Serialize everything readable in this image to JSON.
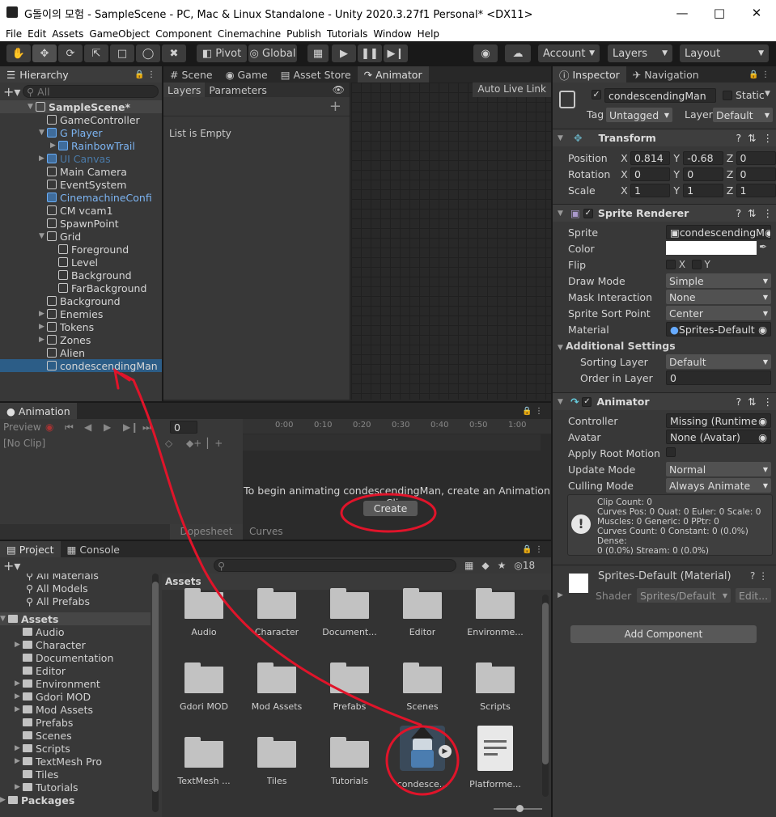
{
  "window": {
    "title": "G돌이의 모험 - SampleScene - PC, Mac & Linux Standalone - Unity 2020.3.27f1 Personal* <DX11>"
  },
  "menu": [
    "File",
    "Edit",
    "Assets",
    "GameObject",
    "Component",
    "Cinemachine",
    "Publish",
    "Tutorials",
    "Window",
    "Help"
  ],
  "toolbar": {
    "pivot": "Pivot",
    "global": "Global",
    "account": "Account",
    "layers": "Layers",
    "layout": "Layout"
  },
  "hierarchy": {
    "tab": "Hierarchy",
    "search_placeholder": "All",
    "items": [
      {
        "label": "SampleScene*",
        "indent": 0,
        "type": "scene"
      },
      {
        "label": "GameController",
        "indent": 1
      },
      {
        "label": "G Player",
        "indent": 1,
        "blue": true
      },
      {
        "label": "RainbowTrail",
        "indent": 2,
        "blue": true
      },
      {
        "label": "UI Canvas",
        "indent": 1,
        "blue": true,
        "dim": true
      },
      {
        "label": "Main Camera",
        "indent": 1
      },
      {
        "label": "EventSystem",
        "indent": 1
      },
      {
        "label": "CinemachineConfi",
        "indent": 1,
        "blue": true
      },
      {
        "label": "CM vcam1",
        "indent": 1
      },
      {
        "label": "SpawnPoint",
        "indent": 1
      },
      {
        "label": "Grid",
        "indent": 1
      },
      {
        "label": "Foreground",
        "indent": 2
      },
      {
        "label": "Level",
        "indent": 2
      },
      {
        "label": "Background",
        "indent": 2
      },
      {
        "label": "FarBackground",
        "indent": 2
      },
      {
        "label": "Background",
        "indent": 1
      },
      {
        "label": "Enemies",
        "indent": 1
      },
      {
        "label": "Tokens",
        "indent": 1
      },
      {
        "label": "Zones",
        "indent": 1
      },
      {
        "label": "Alien",
        "indent": 1
      },
      {
        "label": "condescendingMan",
        "indent": 1,
        "selected": true
      }
    ]
  },
  "center_tabs": [
    "Scene",
    "Game",
    "Asset Store",
    "Animator"
  ],
  "animator": {
    "tab_layers": "Layers",
    "tab_parameters": "Parameters",
    "list_empty": "List is Empty",
    "auto_live_link": "Auto Live Link"
  },
  "animation": {
    "tab": "Animation",
    "preview": "Preview",
    "frame": "0",
    "clip": "[No Clip]",
    "ticks": [
      "0:00",
      "0:10",
      "0:20",
      "0:30",
      "0:40",
      "0:50",
      "1:00"
    ],
    "message": "To begin animating condescendingMan, create an Animation Clip.",
    "create": "Create",
    "dopesheet": "Dopesheet",
    "curves": "Curves"
  },
  "project": {
    "tab_project": "Project",
    "tab_console": "Console",
    "hidden_count": "18",
    "assets_header": "Assets",
    "tree_top": [
      "All Materials",
      "All Models",
      "All Prefabs"
    ],
    "tree": [
      "Audio",
      "Character",
      "Documentation",
      "Editor",
      "Environment",
      "Gdori MOD",
      "Mod Assets",
      "Prefabs",
      "Scenes",
      "Scripts",
      "TextMesh Pro",
      "Tiles",
      "Tutorials"
    ],
    "assets_root": "Assets",
    "packages": "Packages",
    "grid": [
      "Audio",
      "Character",
      "Document...",
      "Editor",
      "Environme...",
      "Gdori MOD",
      "Mod Assets",
      "Prefabs",
      "Scenes",
      "Scripts",
      "TextMesh ...",
      "Tiles",
      "Tutorials",
      "condesce...",
      "Platforme..."
    ]
  },
  "inspector": {
    "tab": "Inspector",
    "tab2": "Navigation",
    "name": "condescendingMan",
    "static": "Static",
    "tag_label": "Tag",
    "tag": "Untagged",
    "layer_label": "Layer",
    "layer": "Default",
    "transform": {
      "title": "Transform",
      "rows": [
        {
          "label": "Position",
          "x": "0.814",
          "y": "-0.68",
          "z": "0"
        },
        {
          "label": "Rotation",
          "x": "0",
          "y": "0",
          "z": "0"
        },
        {
          "label": "Scale",
          "x": "1",
          "y": "1",
          "z": "1"
        }
      ]
    },
    "sprite_renderer": {
      "title": "Sprite Renderer",
      "sprite_label": "Sprite",
      "sprite": "condescendingM",
      "color_label": "Color",
      "flip_label": "Flip",
      "draw_mode_label": "Draw Mode",
      "draw_mode": "Simple",
      "mask_label": "Mask Interaction",
      "mask": "None",
      "sort_point_label": "Sprite Sort Point",
      "sort_point": "Center",
      "material_label": "Material",
      "material": "Sprites-Default",
      "additional": "Additional Settings",
      "sorting_layer_label": "Sorting Layer",
      "sorting_layer": "Default",
      "order_label": "Order in Layer",
      "order": "0"
    },
    "animator": {
      "title": "Animator",
      "controller_label": "Controller",
      "controller": "Missing (Runtime An",
      "avatar_label": "Avatar",
      "avatar": "None (Avatar)",
      "root_motion_label": "Apply Root Motion",
      "update_label": "Update Mode",
      "update": "Normal",
      "culling_label": "Culling Mode",
      "culling": "Always Animate",
      "info": [
        "Clip Count: 0",
        "Curves Pos: 0 Quat: 0 Euler: 0 Scale: 0",
        "Muscles: 0 Generic: 0 PPtr: 0",
        "Curves Count: 0 Constant: 0 (0.0%) Dense:",
        "0 (0.0%) Stream: 0 (0.0%)"
      ]
    },
    "material": {
      "title": "Sprites-Default (Material)",
      "shader_label": "Shader",
      "shader": "Sprites/Default",
      "edit": "Edit..."
    },
    "add_component": "Add Component"
  },
  "colors": {
    "accent": "#2c5d87",
    "annotation": "#e0142a"
  }
}
